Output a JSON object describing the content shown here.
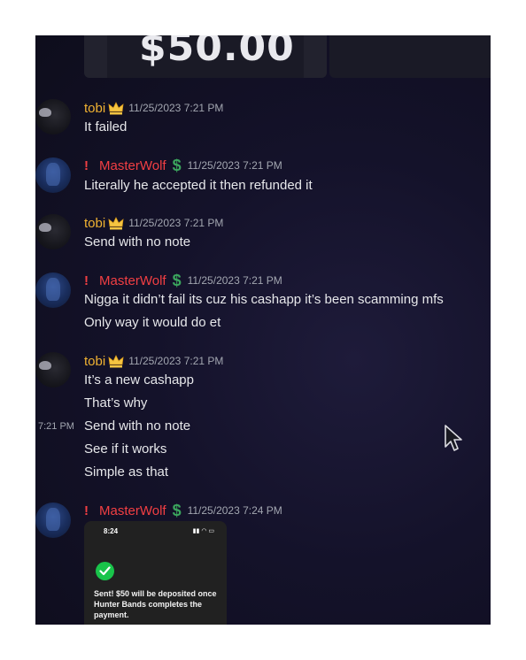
{
  "header": {
    "amount": "$50.00"
  },
  "messages": [
    {
      "author": "tobi",
      "timestamp": "11/25/2023 7:21 PM",
      "lines": [
        "It failed"
      ]
    },
    {
      "author": "MasterWolf",
      "timestamp": "11/25/2023 7:21 PM",
      "lines": [
        "Literally he accepted it then refunded it"
      ]
    },
    {
      "author": "tobi",
      "timestamp": "11/25/2023 7:21 PM",
      "lines": [
        "Send with no note"
      ]
    },
    {
      "author": "MasterWolf",
      "timestamp": "11/25/2023 7:21 PM",
      "lines": [
        "Nigga it didn’t fail its cuz his cashapp it’s been scamming mfs",
        "Only way it would do et"
      ]
    },
    {
      "author": "tobi",
      "timestamp": "11/25/2023 7:21 PM",
      "lines": [
        "It’s a new cashapp",
        "That’s why",
        "Send with no note",
        "See if it works",
        "Simple as that"
      ],
      "hover_time": "7:21 PM"
    },
    {
      "author": "MasterWolf",
      "timestamp": "11/25/2023 7:24 PM",
      "lines": []
    }
  ],
  "attachment": {
    "phone_time": "8:24",
    "status_text": "Sent! $50 will be deposited once Hunter Bands completes the payment."
  },
  "badges": {
    "masterwolf_prefix": "!"
  },
  "colors": {
    "tobi": "#f0b232",
    "masterwolf": "#f23f43",
    "cash": "#3ba55d",
    "text": "#e6e7ea",
    "timestamp": "#a2a6b0"
  },
  "icons": [
    "crown-icon",
    "dollar-icon",
    "check-icon",
    "cursor-icon"
  ]
}
